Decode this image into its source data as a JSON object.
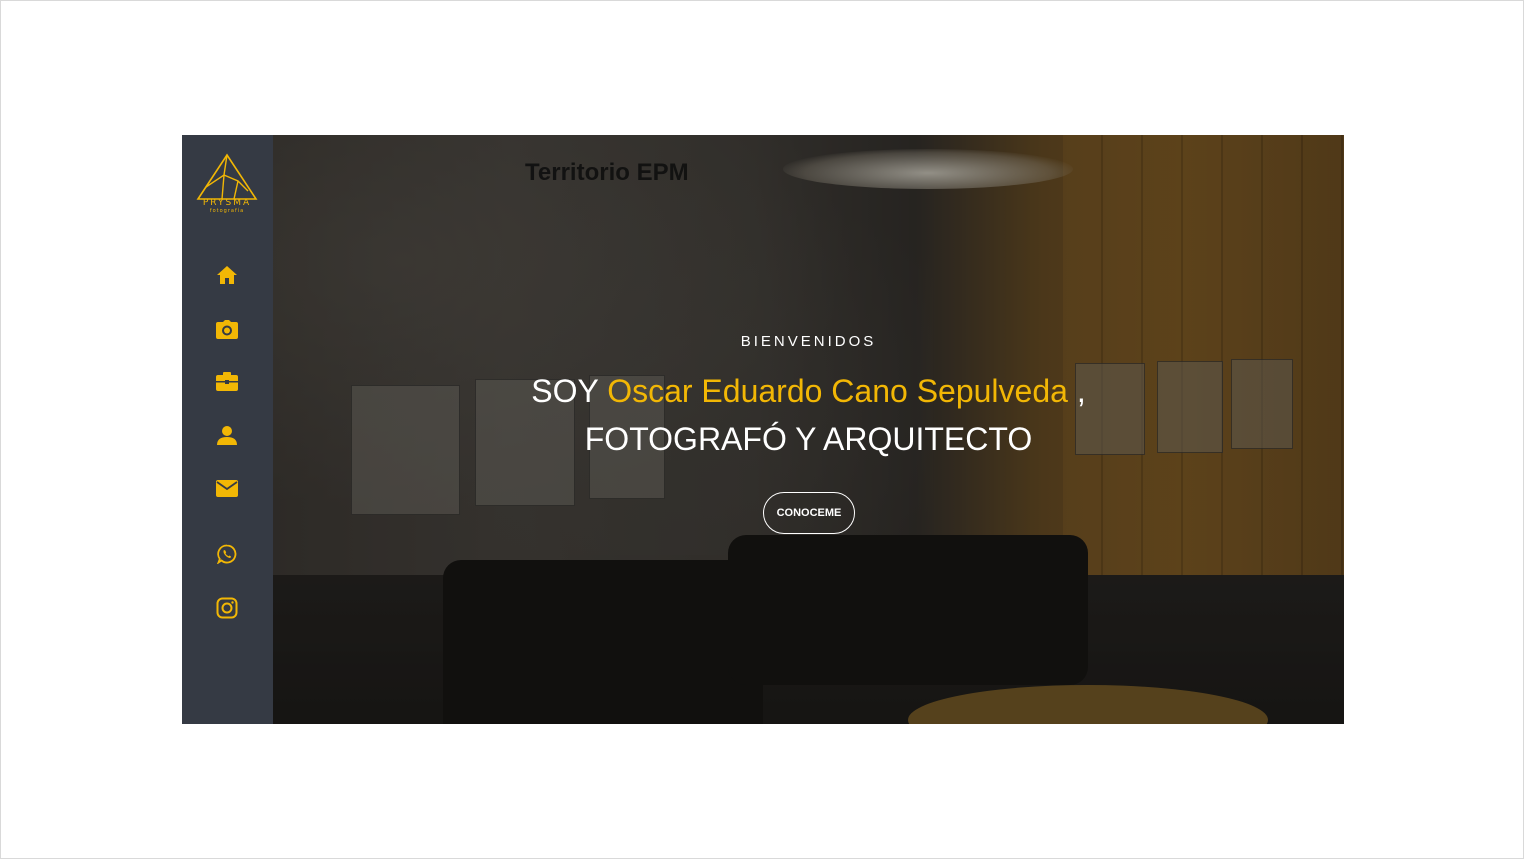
{
  "brand": {
    "logo_name": "PRYSMA",
    "logo_tagline": "fotografía"
  },
  "nav": {
    "items": [
      {
        "icon": "home-icon"
      },
      {
        "icon": "camera-icon"
      },
      {
        "icon": "briefcase-icon"
      },
      {
        "icon": "user-icon"
      },
      {
        "icon": "envelope-icon"
      },
      {
        "icon": "whatsapp-icon"
      },
      {
        "icon": "instagram-icon"
      }
    ]
  },
  "hero": {
    "kicker": "BIENVENIDOS",
    "prefix": "SOY ",
    "name": "Oscar Eduardo Cano Sepulveda",
    "suffix": " ,",
    "role": "FOTOGRAFÓ Y ARQUITECTO",
    "cta_label": "CONOCEME",
    "background_sign": "Territorio EPM"
  },
  "colors": {
    "accent": "#f2b705",
    "sidebar": "#353a44",
    "text": "#ffffff"
  }
}
